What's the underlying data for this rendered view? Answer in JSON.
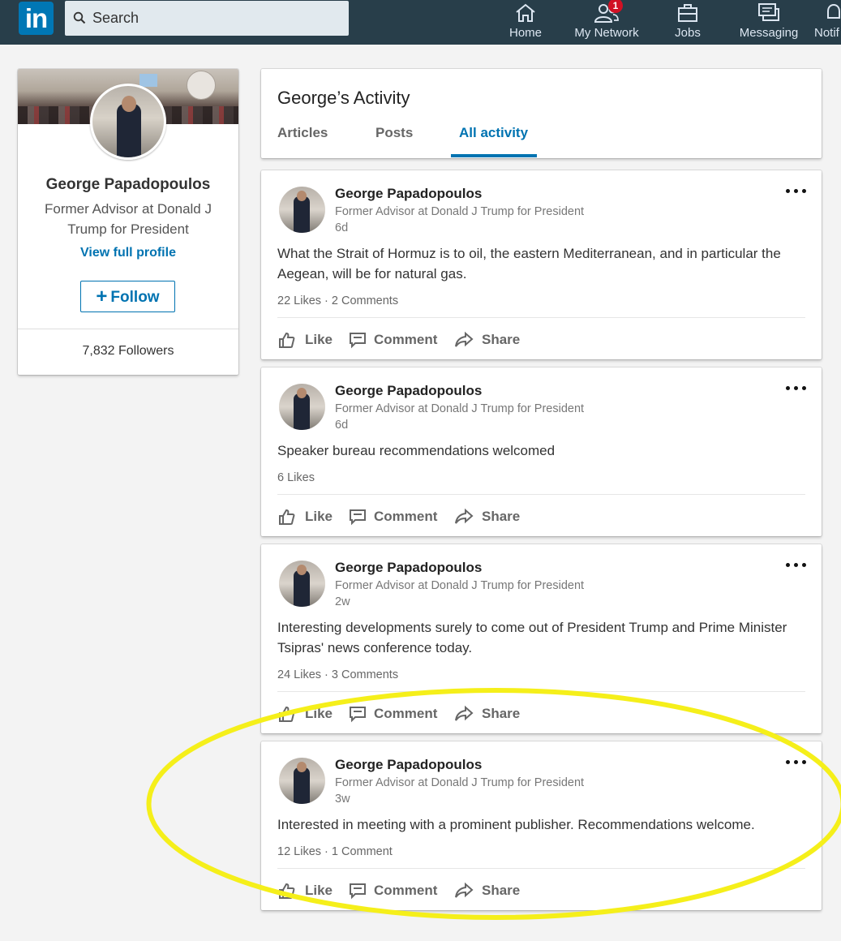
{
  "nav": {
    "logo_text": "in",
    "search_placeholder": "Search",
    "items": [
      {
        "label": "Home",
        "icon": "home-icon"
      },
      {
        "label": "My Network",
        "icon": "network-icon",
        "badge": "1"
      },
      {
        "label": "Jobs",
        "icon": "briefcase-icon"
      },
      {
        "label": "Messaging",
        "icon": "messaging-icon"
      },
      {
        "label": "Notif",
        "icon": "bell-icon"
      }
    ],
    "background_color": "#283e4a",
    "accent_color": "#0077b5"
  },
  "profile": {
    "name": "George Papadopoulos",
    "headline": "Former Advisor at Donald J Trump for President",
    "view_profile_label": "View full profile",
    "follow_label": "Follow",
    "followers": "7,832 Followers"
  },
  "activity": {
    "title": "George’s Activity",
    "tabs": [
      {
        "label": "Articles",
        "active": false
      },
      {
        "label": "Posts",
        "active": false
      },
      {
        "label": "All activity",
        "active": true
      }
    ]
  },
  "action_labels": {
    "like": "Like",
    "comment": "Comment",
    "share": "Share"
  },
  "posts": [
    {
      "author": "George Papadopoulos",
      "headline": "Former Advisor at Donald J Trump for President",
      "age": "6d",
      "text": "What the Strait of Hormuz is to oil, the eastern Mediterranean, and in particular the Aegean, will be for natural gas.",
      "stats": "22 Likes · 2 Comments"
    },
    {
      "author": "George Papadopoulos",
      "headline": "Former Advisor at Donald J Trump for President",
      "age": "6d",
      "text": "Speaker bureau recommendations welcomed",
      "stats": "6 Likes"
    },
    {
      "author": "George Papadopoulos",
      "headline": "Former Advisor at Donald J Trump for President",
      "age": "2w",
      "text": "Interesting developments surely to come out of President Trump and Prime Minister Tsipras' news conference today.",
      "stats": "24 Likes · 3 Comments"
    },
    {
      "author": "George Papadopoulos",
      "headline": "Former Advisor at Donald J Trump for President",
      "age": "3w",
      "text": "Interested in meeting with a prominent publisher. Recommendations welcome.",
      "stats": "12 Likes · 1 Comment"
    }
  ],
  "annotation": {
    "highlight_color": "#f5ef1a"
  }
}
